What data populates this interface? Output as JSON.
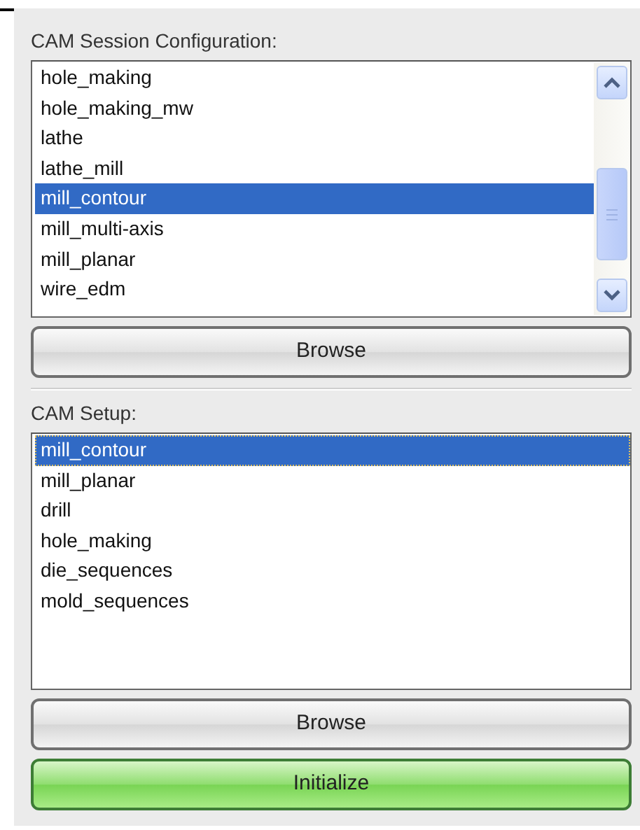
{
  "session_config": {
    "label": "CAM Session Configuration:",
    "items": [
      {
        "label": "hole_making",
        "selected": false
      },
      {
        "label": "hole_making_mw",
        "selected": false
      },
      {
        "label": "lathe",
        "selected": false
      },
      {
        "label": "lathe_mill",
        "selected": false
      },
      {
        "label": "mill_contour",
        "selected": true
      },
      {
        "label": "mill_multi-axis",
        "selected": false
      },
      {
        "label": "mill_planar",
        "selected": false
      },
      {
        "label": "wire_edm",
        "selected": false
      }
    ],
    "scrollbar": true,
    "button": {
      "label": "Browse",
      "kind": "default"
    }
  },
  "setup": {
    "label": "CAM Setup:",
    "items": [
      {
        "label": "mill_contour",
        "selected": true
      },
      {
        "label": "mill_planar",
        "selected": false
      },
      {
        "label": "drill",
        "selected": false
      },
      {
        "label": "hole_making",
        "selected": false
      },
      {
        "label": "die_sequences",
        "selected": false
      },
      {
        "label": "mold_sequences",
        "selected": false
      }
    ],
    "scrollbar": false,
    "buttons": [
      {
        "label": "Browse",
        "kind": "default"
      },
      {
        "label": "Initialize",
        "kind": "go"
      }
    ]
  }
}
